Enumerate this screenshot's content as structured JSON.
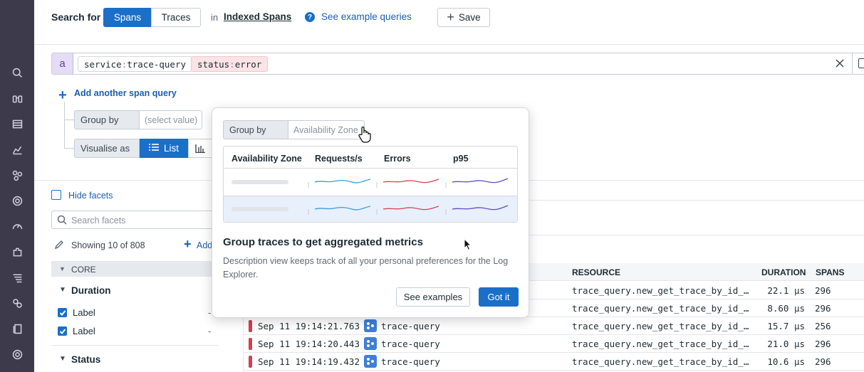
{
  "query_bar": {
    "search_for_label": "Search for",
    "seg_spans": "Spans",
    "seg_traces": "Traces",
    "in_label": "in",
    "index_link": "Indexed Spans",
    "example_link": "See example queries",
    "save_label": "Save"
  },
  "query": {
    "letter": "a",
    "tag1_key": "service",
    "tag1_val": "trace-query",
    "tag2_key": "status",
    "tag2_val": "error",
    "colon": ":",
    "add_query": "Add another span query"
  },
  "group_row": {
    "label": "Group by",
    "placeholder": "(select value)"
  },
  "visualise_row": {
    "label": "Visualise as",
    "list_label": "List"
  },
  "facets": {
    "hide_label": "Hide facets",
    "search_placeholder": "Search facets",
    "showing": "Showing 10 of 808",
    "add_label": "Add",
    "section": "CORE",
    "duration_title": "Duration",
    "items": [
      {
        "label": "Label",
        "value": "-"
      },
      {
        "label": "Label",
        "value": "-"
      }
    ],
    "status_title": "Status"
  },
  "table": {
    "headers": {
      "resource": "RESOURCE",
      "duration": "DURATION",
      "spans": "SPANS"
    },
    "rows": [
      {
        "date": "",
        "service": "",
        "resource": "trace_query.new_get_trace_by_id_…",
        "duration": "22.1 µs",
        "spans": "296"
      },
      {
        "date": "",
        "service": "",
        "resource": "trace_query.new_get_trace_by_id_…",
        "duration": "8.60 µs",
        "spans": "296"
      },
      {
        "date": "Sep 11 19:14:21.763",
        "service": "trace-query",
        "resource": "trace_query.new_get_trace_by_id_…",
        "duration": "15.7 µs",
        "spans": "256"
      },
      {
        "date": "Sep 11 19:14:20.443",
        "service": "trace-query",
        "resource": "trace_query.new_get_trace_by_id_…",
        "duration": "21.0 µs",
        "spans": "296"
      },
      {
        "date": "Sep 11 19:14:19.432",
        "service": "trace-query",
        "resource": "trace_query.new_get_trace_by_id_…",
        "duration": "10.6 µs",
        "spans": "296"
      }
    ]
  },
  "popover": {
    "group_label": "Group by",
    "group_value": "Availability Zone",
    "columns": [
      "Availability Zone",
      "Requests/s",
      "Errors",
      "p95"
    ],
    "title": "Group traces to get aggregated metrics",
    "description": "Description view keeps track of all your personal preferences for the Log Explorer.",
    "see_examples": "See examples",
    "got_it": "Got it"
  },
  "colors": {
    "accent": "#1a6fc9",
    "rail": "#3d3a4b",
    "error": "#d2404e",
    "requests_line": "#3d9be0",
    "errors_line": "#d94257",
    "p95_line": "#5b4fc4"
  }
}
